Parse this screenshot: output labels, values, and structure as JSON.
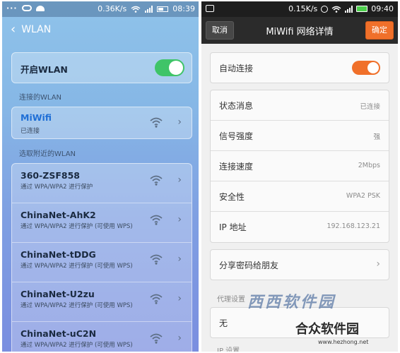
{
  "left": {
    "status": {
      "left_dots": "···",
      "speed": "0.36K/s",
      "time": "08:39"
    },
    "title": "WLAN",
    "toggle": {
      "label": "开启WLAN",
      "on": true
    },
    "connected_section": "连接的WLAN",
    "connected": {
      "name": "MiWifi",
      "status": "已连接",
      "accent": "#1f6fd6"
    },
    "nearby_section": "选取附近的WLAN",
    "networks": [
      {
        "name": "360-ZSF858",
        "desc": "通过 WPA/WPA2 进行保护"
      },
      {
        "name": "ChinaNet-AhK2",
        "desc": "通过 WPA/WPA2 进行保护 (可使用 WPS)"
      },
      {
        "name": "ChinaNet-tDDG",
        "desc": "通过 WPA/WPA2 进行保护 (可使用 WPS)"
      },
      {
        "name": "ChinaNet-U2zu",
        "desc": "通过 WPA/WPA2 进行保护 (可使用 WPS)"
      },
      {
        "name": "ChinaNet-uC2N",
        "desc": "通过 WPA/WPA2 进行保护 (可使用 WPS)"
      }
    ]
  },
  "right": {
    "status": {
      "speed": "0.15K/s",
      "time": "09:40"
    },
    "action_bar": {
      "cancel": "取消",
      "title": "MiWifi 网络详情",
      "ok": "确定"
    },
    "auto_connect": {
      "label": "自动连接",
      "on": true
    },
    "details": [
      {
        "key": "状态消息",
        "value": "已连接"
      },
      {
        "key": "信号强度",
        "value": "强"
      },
      {
        "key": "连接速度",
        "value": "2Mbps"
      },
      {
        "key": "安全性",
        "value": "WPA2 PSK"
      },
      {
        "key": "IP 地址",
        "value": "192.168.123.21"
      }
    ],
    "share": {
      "label": "分享密码给朋友"
    },
    "proxy_section": "代理设置",
    "proxy_value": "无",
    "ip_section": "IP 设置"
  },
  "watermark": {
    "logo": "西西软件园",
    "text": "合众软件园",
    "url": "www.hezhong.net"
  }
}
